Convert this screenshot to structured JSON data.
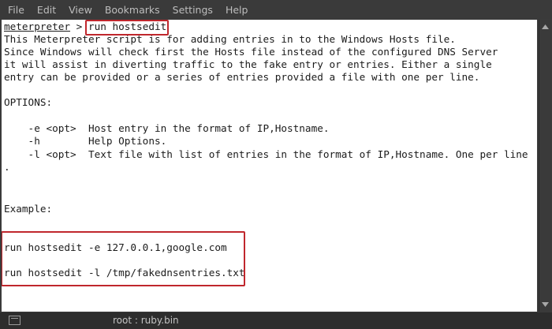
{
  "menu": {
    "items": [
      {
        "label": "File"
      },
      {
        "label": "Edit"
      },
      {
        "label": "View"
      },
      {
        "label": "Bookmarks"
      },
      {
        "label": "Settings"
      },
      {
        "label": "Help"
      }
    ]
  },
  "terminal": {
    "prompt": "meterpreter",
    "prompt_sep": " > ",
    "command": "run hostsedit",
    "lines": [
      "This Meterpreter script is for adding entries in to the Windows Hosts file.",
      "Since Windows will check first the Hosts file instead of the configured DNS Server",
      "it will assist in diverting traffic to the fake entry or entries. Either a single",
      "entry can be provided or a series of entries provided a file with one per line.",
      "",
      "OPTIONS:",
      "",
      "    -e <opt>  Host entry in the format of IP,Hostname.",
      "    -h        Help Options.",
      "    -l <opt>  Text file with list of entries in the format of IP,Hostname. One per line",
      ".",
      "",
      "",
      "Example:",
      "",
      "",
      "run hostsedit -e 127.0.0.1,google.com",
      "",
      "run hostsedit -l /tmp/fakednsentries.txt"
    ]
  },
  "taskbar": {
    "tab_title": "root : ruby.bin"
  },
  "colors": {
    "highlight": "#c0272d",
    "terminal_bg": "#ffffff",
    "chrome_bg": "#3a3a3a"
  }
}
